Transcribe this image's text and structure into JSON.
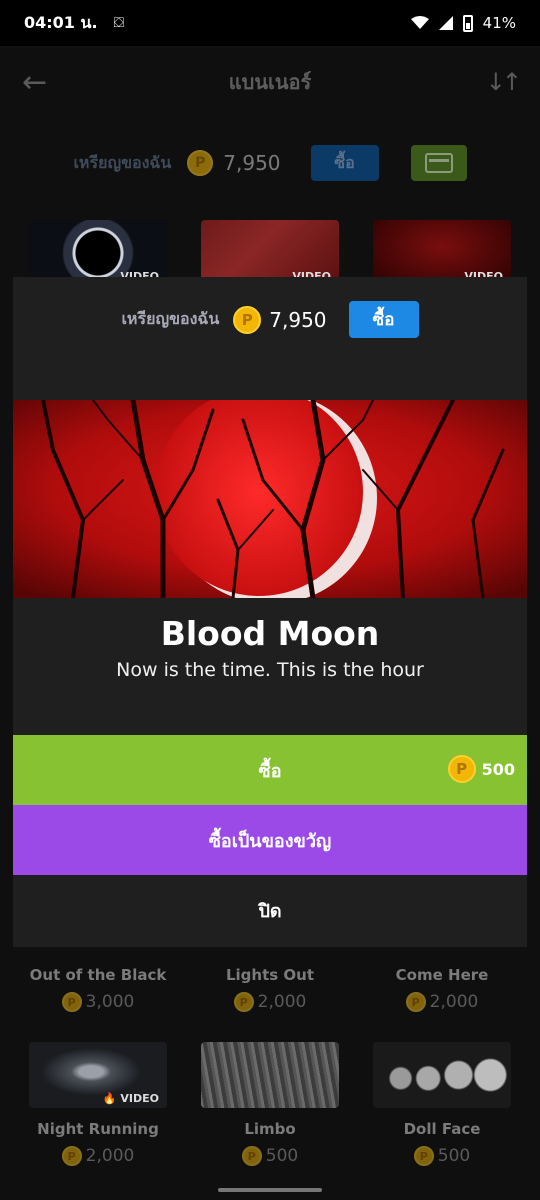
{
  "status": {
    "time": "04:01 น.",
    "battery": "41%"
  },
  "header": {
    "title": "แบนเนอร์"
  },
  "coins": {
    "label": "เหรียญของฉัน",
    "amount": "7,950",
    "buy_label": "ซื้อ",
    "coin_symbol": "P"
  },
  "grid_top": [
    {
      "video": "VIDEO"
    },
    {
      "video": "VIDEO"
    },
    {
      "video": "VIDEO"
    }
  ],
  "grid_mid": [
    {
      "name": "Out of the Black",
      "price": "3,000"
    },
    {
      "name": "Lights Out",
      "price": "2,000"
    },
    {
      "name": "Come Here",
      "price": "2,000"
    }
  ],
  "grid_bot": [
    {
      "name": "Night Running",
      "price": "2,000",
      "video": "VIDEO"
    },
    {
      "name": "Limbo",
      "price": "500"
    },
    {
      "name": "Doll Face",
      "price": "500"
    }
  ],
  "modal": {
    "coin_label": "เหรียญของฉัน",
    "coin_amount": "7,950",
    "buy_coins_label": "ซื้อ",
    "title": "Blood Moon",
    "subtitle": "Now is the time. This is the hour",
    "buy_label": "ซื้อ",
    "price": "500",
    "gift_label": "ซื้อเป็นของขวัญ",
    "close_label": "ปิด"
  },
  "colors": {
    "buy_green": "#86c232",
    "gift_purple": "#9b4ae8",
    "coin_blue": "#1e88e5",
    "coin_gold": "#f2b705"
  }
}
